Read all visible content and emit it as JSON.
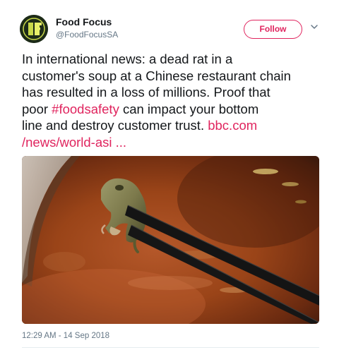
{
  "tweet": {
    "author": {
      "name": "Food Focus",
      "handle": "@FoodFocusSA"
    },
    "follow_label": "Follow",
    "text": {
      "line1": "In international news: a dead rat in a",
      "line2": "customer's soup at a Chinese restaurant chain",
      "line3": "has resulted in a loss of millions.  Proof that",
      "line4_before": "poor ",
      "hashtag": "#foodsafety",
      "line4_after": " can impact your bottom",
      "line5_before": "line and destroy customer trust.  ",
      "link_part1": "bbc.com",
      "link_part2": "/news/world-asi ..."
    },
    "timestamp": "12:29 AM - 14 Sep 2018"
  },
  "colors": {
    "accent": "#e0245e",
    "secondary_text": "#657786",
    "primary_text": "#14171a"
  },
  "icons": {
    "avatar": "food-focus-logo",
    "caret": "chevron-down-icon"
  }
}
